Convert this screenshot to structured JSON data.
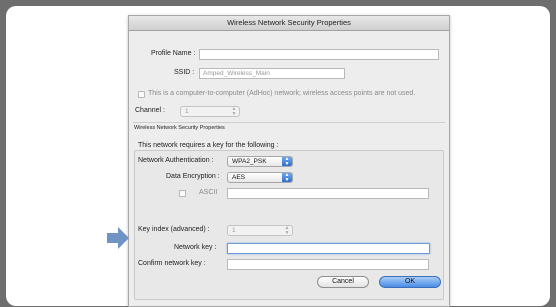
{
  "dialog": {
    "title": "Wireless Network Security Properties",
    "profile_label": "Profile Name :",
    "profile_value": "",
    "ssid_label": "SSID :",
    "ssid_value": "Amped_Wireless_Main",
    "adhoc_label": "This is a computer-to-computer (AdHoc) network; wireless access points are not used.",
    "channel_label": "Channel :",
    "channel_value": "1"
  },
  "security": {
    "group_title": "Wireless Network Security Properties",
    "requires_text": "This network requires a key for the following :",
    "auth_label": "Network Authentication :",
    "auth_value": "WPA2_PSK",
    "enc_label": "Data Encryption :",
    "enc_value": "AES",
    "ascii_label": "ASCII",
    "ascii_value": "",
    "key_index_label": "Key index (advanced) :",
    "key_index_value": "1",
    "network_key_label": "Network key :",
    "network_key_value": "",
    "confirm_key_label": "Confirm network key :",
    "confirm_key_value": ""
  },
  "buttons": {
    "cancel": "Cancel",
    "ok": "OK"
  },
  "colors": {
    "pointer": "#6f93c4",
    "ok_button": "#4a8ce6",
    "focus_ring": "#6c9ad6"
  }
}
